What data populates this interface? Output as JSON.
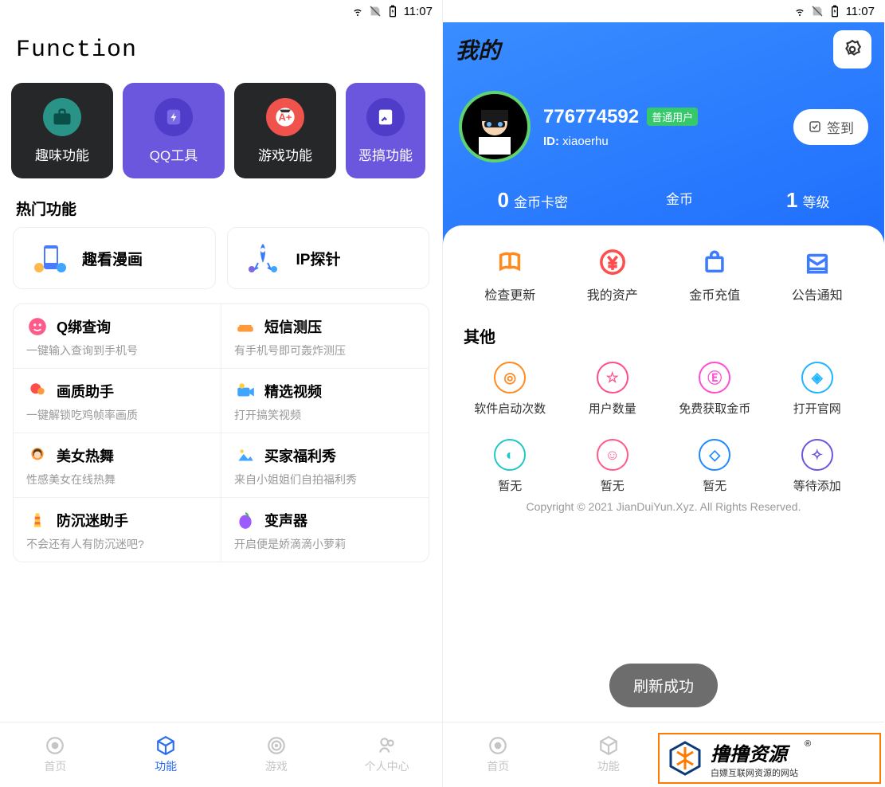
{
  "statusBar": {
    "time": "11:07"
  },
  "left": {
    "title": "Function",
    "categories": [
      {
        "label": "趣味功能"
      },
      {
        "label": "QQ工具"
      },
      {
        "label": "游戏功能"
      },
      {
        "label": "恶搞功能"
      }
    ],
    "hotTitle": "热门功能",
    "featured": [
      {
        "label": "趣看漫画"
      },
      {
        "label": "IP探针"
      }
    ],
    "list": [
      [
        {
          "title": "Q绑查询",
          "sub": "一键输入查询到手机号",
          "color": "#ff5b8a"
        },
        {
          "title": "短信测压",
          "sub": "有手机号即可轰炸测压",
          "color": "#ff9a3c"
        }
      ],
      [
        {
          "title": "画质助手",
          "sub": "一键解锁吃鸡帧率画质",
          "color": "#ff4d4d"
        },
        {
          "title": "精选视频",
          "sub": "打开搞笑视频",
          "color": "#3fa5ff"
        }
      ],
      [
        {
          "title": "美女热舞",
          "sub": "性感美女在线热舞",
          "color": "#ff9a3c"
        },
        {
          "title": "买家福利秀",
          "sub": "来自小姐姐们自拍福利秀",
          "color": "#3fa5ff"
        }
      ],
      [
        {
          "title": "防沉迷助手",
          "sub": "不会还有人有防沉迷吧?",
          "color": "#ffcf3f"
        },
        {
          "title": "变声器",
          "sub": "开启便是娇滴滴小萝莉",
          "color": "#9b5bff"
        }
      ]
    ],
    "nav": [
      {
        "label": "首页"
      },
      {
        "label": "功能"
      },
      {
        "label": "游戏"
      },
      {
        "label": "个人中心"
      }
    ],
    "navActive": 1
  },
  "right": {
    "title": "我的",
    "uid": "776774592",
    "badge": "普通用户",
    "idLabel": "ID:",
    "idValue": "xiaoerhu",
    "checkin": "签到",
    "stats": [
      {
        "n": "0",
        "label": "金币卡密"
      },
      {
        "n": "",
        "label": "金币"
      },
      {
        "n": "1",
        "label": "等级"
      }
    ],
    "panelButtons": [
      {
        "label": "检查更新",
        "color": "#ff8a1f"
      },
      {
        "label": "我的资产",
        "color": "#ff4d4d"
      },
      {
        "label": "金币充值",
        "color": "#3f7bff"
      },
      {
        "label": "公告通知",
        "color": "#3f7bff"
      }
    ],
    "otherTitle": "其他",
    "otherButtons": [
      {
        "label": "软件启动次数",
        "color": "#ff8a1f"
      },
      {
        "label": "用户数量",
        "color": "#ff4d8a"
      },
      {
        "label": "免费获取金币",
        "color": "#ff4dd2"
      },
      {
        "label": "打开官网",
        "color": "#1fb5ff"
      },
      {
        "label": "暂无",
        "color": "#1fc7c7"
      },
      {
        "label": "暂无",
        "color": "#ff5b8a"
      },
      {
        "label": "暂无",
        "color": "#1f8aff"
      },
      {
        "label": "等待添加",
        "color": "#6b57dd"
      }
    ],
    "toast": "刷新成功",
    "copyright": "Copyright © 2021 JianDuiYun.Xyz. All Rights Reserved.",
    "nav": [
      {
        "label": "首页"
      },
      {
        "label": "功能"
      }
    ],
    "watermark": {
      "line1": "撸撸资源",
      "line2": "白嫖互联网资源的网站",
      "r": "®"
    }
  }
}
